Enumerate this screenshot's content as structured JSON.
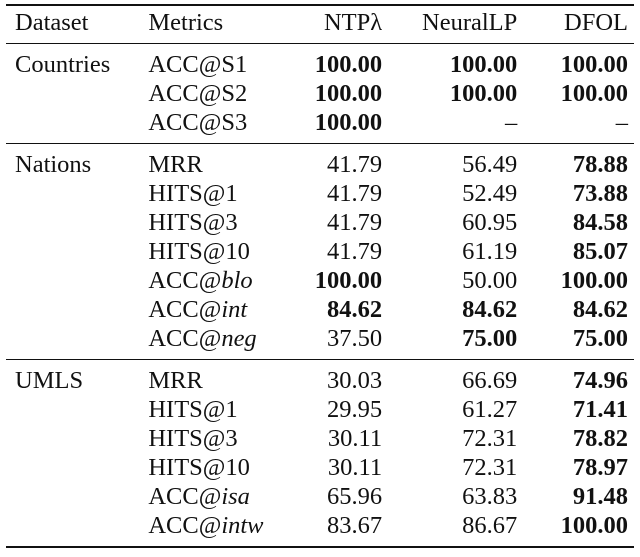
{
  "table": {
    "headers": [
      "Dataset",
      "Metrics",
      "NTPλ",
      "NeuralLP",
      "DFOL"
    ],
    "groups": [
      {
        "dataset": "Countries",
        "rows": [
          {
            "metric_prefix": "ACC@",
            "metric_suffix": "S1",
            "metric_suffix_italic": false,
            "values": [
              "100.00",
              "100.00",
              "100.00"
            ],
            "bold": [
              true,
              true,
              true
            ]
          },
          {
            "metric_prefix": "ACC@",
            "metric_suffix": "S2",
            "metric_suffix_italic": false,
            "values": [
              "100.00",
              "100.00",
              "100.00"
            ],
            "bold": [
              true,
              true,
              true
            ]
          },
          {
            "metric_prefix": "ACC@",
            "metric_suffix": "S3",
            "metric_suffix_italic": false,
            "values": [
              "100.00",
              "–",
              "–"
            ],
            "bold": [
              true,
              false,
              false
            ]
          }
        ]
      },
      {
        "dataset": "Nations",
        "rows": [
          {
            "metric_prefix": "MRR",
            "metric_suffix": "",
            "metric_suffix_italic": false,
            "values": [
              "41.79",
              "56.49",
              "78.88"
            ],
            "bold": [
              false,
              false,
              true
            ]
          },
          {
            "metric_prefix": "HITS@1",
            "metric_suffix": "",
            "metric_suffix_italic": false,
            "values": [
              "41.79",
              "52.49",
              "73.88"
            ],
            "bold": [
              false,
              false,
              true
            ]
          },
          {
            "metric_prefix": "HITS@3",
            "metric_suffix": "",
            "metric_suffix_italic": false,
            "values": [
              "41.79",
              "60.95",
              "84.58"
            ],
            "bold": [
              false,
              false,
              true
            ]
          },
          {
            "metric_prefix": "HITS@10",
            "metric_suffix": "",
            "metric_suffix_italic": false,
            "values": [
              "41.79",
              "61.19",
              "85.07"
            ],
            "bold": [
              false,
              false,
              true
            ]
          },
          {
            "metric_prefix": "ACC@",
            "metric_suffix": "blo",
            "metric_suffix_italic": true,
            "values": [
              "100.00",
              "50.00",
              "100.00"
            ],
            "bold": [
              true,
              false,
              true
            ]
          },
          {
            "metric_prefix": "ACC@",
            "metric_suffix": "int",
            "metric_suffix_italic": true,
            "values": [
              "84.62",
              "84.62",
              "84.62"
            ],
            "bold": [
              true,
              true,
              true
            ]
          },
          {
            "metric_prefix": "ACC@",
            "metric_suffix": "neg",
            "metric_suffix_italic": true,
            "values": [
              "37.50",
              "75.00",
              "75.00"
            ],
            "bold": [
              false,
              true,
              true
            ]
          }
        ]
      },
      {
        "dataset": "UMLS",
        "rows": [
          {
            "metric_prefix": "MRR",
            "metric_suffix": "",
            "metric_suffix_italic": false,
            "values": [
              "30.03",
              "66.69",
              "74.96"
            ],
            "bold": [
              false,
              false,
              true
            ]
          },
          {
            "metric_prefix": "HITS@1",
            "metric_suffix": "",
            "metric_suffix_italic": false,
            "values": [
              "29.95",
              "61.27",
              "71.41"
            ],
            "bold": [
              false,
              false,
              true
            ]
          },
          {
            "metric_prefix": "HITS@3",
            "metric_suffix": "",
            "metric_suffix_italic": false,
            "values": [
              "30.11",
              "72.31",
              "78.82"
            ],
            "bold": [
              false,
              false,
              true
            ]
          },
          {
            "metric_prefix": "HITS@10",
            "metric_suffix": "",
            "metric_suffix_italic": false,
            "values": [
              "30.11",
              "72.31",
              "78.97"
            ],
            "bold": [
              false,
              false,
              true
            ]
          },
          {
            "metric_prefix": "ACC@",
            "metric_suffix": "isa",
            "metric_suffix_italic": true,
            "values": [
              "65.96",
              "63.83",
              "91.48"
            ],
            "bold": [
              false,
              false,
              true
            ]
          },
          {
            "metric_prefix": "ACC@",
            "metric_suffix": "intw",
            "metric_suffix_italic": true,
            "values": [
              "83.67",
              "86.67",
              "100.00"
            ],
            "bold": [
              false,
              false,
              true
            ]
          }
        ]
      }
    ]
  }
}
